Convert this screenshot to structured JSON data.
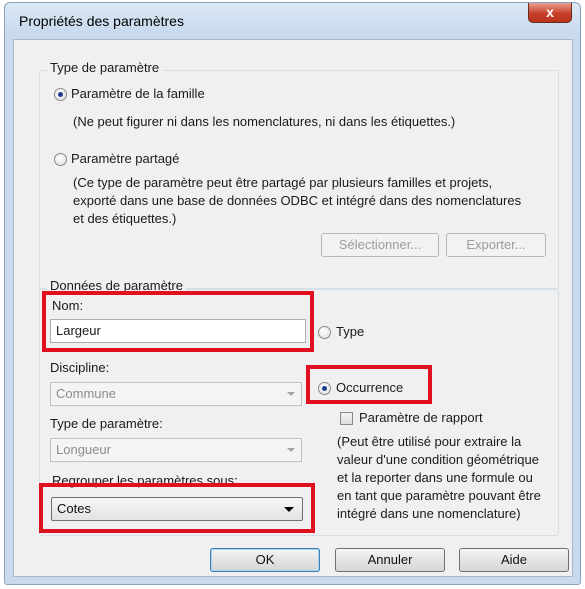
{
  "window": {
    "title": "Propriétés des paramètres",
    "close_glyph": "x"
  },
  "param_type_group": {
    "legend": "Type de paramètre",
    "family_radio_label": "Paramètre de la famille",
    "family_note": "(Ne peut figurer ni dans les nomenclatures, ni dans les étiquettes.)",
    "shared_radio_label": "Paramètre partagé",
    "shared_note_lines": [
      "(Ce type de paramètre peut être partagé par plusieurs familles et projets,",
      "exporté dans une base de données ODBC et intégré dans des nomenclatures",
      "et des étiquettes.)"
    ],
    "select_button": "Sélectionner...",
    "export_button": "Exporter..."
  },
  "param_data_group": {
    "legend": "Données de paramètre",
    "name_label": "Nom:",
    "name_value": "Largeur",
    "type_radio_label": "Type",
    "discipline_label": "Discipline:",
    "discipline_value": "Commune",
    "occurrence_radio_label": "Occurrence",
    "report_checkbox_label": "Paramètre de rapport",
    "param_type_label": "Type de paramètre:",
    "param_type_value": "Longueur",
    "group_label": "Regrouper les paramètres sous:",
    "group_value": "Cotes",
    "report_note_lines": [
      "(Peut être utilisé pour extraire la",
      "valeur d'une condition géométrique",
      "et la reporter dans une formule ou",
      "en tant que paramètre pouvant être",
      "intégré dans une nomenclature)"
    ]
  },
  "buttons": {
    "ok": "OK",
    "cancel": "Annuler",
    "help": "Aide"
  },
  "colors": {
    "highlight": "#e01020",
    "title_bg": "#c9daee",
    "client_bg": "#f0f0f0"
  }
}
